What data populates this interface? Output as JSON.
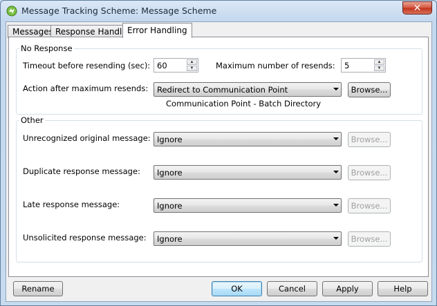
{
  "window": {
    "title": "Message Tracking Scheme: Message Scheme",
    "close_glyph": "✕"
  },
  "tabs": [
    "Messages",
    "Response Handling",
    "Error Handling"
  ],
  "no_response": {
    "title": "No Response",
    "timeout_label": "Timeout before resending (sec):",
    "timeout_value": "60",
    "max_resends_label": "Maximum number of resends:",
    "max_resends_value": "5",
    "action_label": "Action after maximum resends:",
    "action_value": "Redirect to Communication Point",
    "browse_label": "Browse...",
    "comm_point_text": "Communication Point - Batch Directory"
  },
  "other": {
    "title": "Other",
    "rows": [
      {
        "label": "Unrecognized original message:",
        "value": "Ignore",
        "browse": "Browse..."
      },
      {
        "label": "Duplicate response message:",
        "value": "Ignore",
        "browse": "Browse..."
      },
      {
        "label": "Late response message:",
        "value": "Ignore",
        "browse": "Browse..."
      },
      {
        "label": "Unsolicited response message:",
        "value": "Ignore",
        "browse": "Browse..."
      }
    ]
  },
  "footer": {
    "rename": "Rename",
    "ok": "OK",
    "cancel": "Cancel",
    "apply": "Apply",
    "help": "Help"
  },
  "colors": {
    "close_button": "#c2321d",
    "default_button_border": "#3c7fb1"
  }
}
